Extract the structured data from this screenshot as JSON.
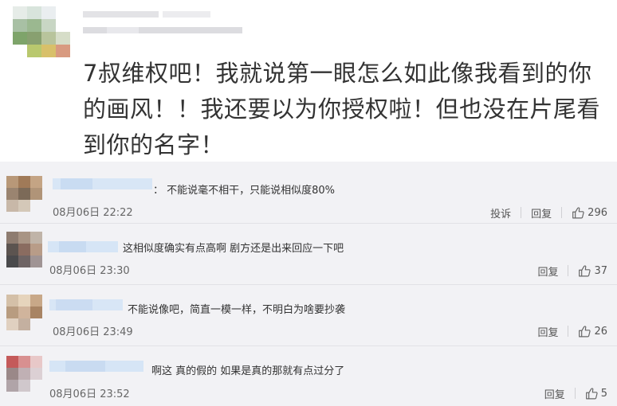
{
  "post": {
    "text": "7叔维权吧！我就说第一眼怎么如此像我看到的你的画风！！我还要以为你授权啦！但也没在片尾看到你的名字！"
  },
  "comments": [
    {
      "text": "：  不能说毫不相干，只能说相似度80%",
      "time": "08月06日 22:22",
      "report_label": "投诉",
      "reply_label": "回复",
      "likes": "296"
    },
    {
      "text": "这相似度确实有点高啊 剧方还是出来回应一下吧",
      "time": "08月06日 23:30",
      "reply_label": "回复",
      "likes": "37"
    },
    {
      "text": "不能说像吧，简直一模一样，不明白为啥要抄袭",
      "time": "08月06日 23:49",
      "reply_label": "回复",
      "likes": "26"
    },
    {
      "text": "啊这 真的假的 如果是真的那就有点过分了",
      "time": "08月06日 23:52",
      "reply_label": "回复",
      "likes": "5"
    }
  ],
  "colors": {
    "page_bg": "#ffffff",
    "comment_bg": "#f2f2f5",
    "text": "#333333",
    "muted": "#666666",
    "blur_blue": "#cfe0f4"
  },
  "icons": {
    "like": "thumbs-up-icon"
  }
}
